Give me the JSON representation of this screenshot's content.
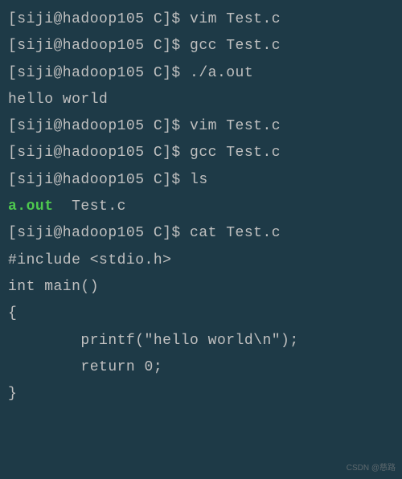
{
  "prompt": "[siji@hadoop105 C]$ ",
  "lines": {
    "cmd1": "vim Test.c",
    "cmd2": "gcc Test.c",
    "cmd3": "./a.out",
    "out1": "hello world",
    "cmd4": "vim Test.c",
    "cmd5": "gcc Test.c",
    "cmd6": "ls",
    "ls_exec": "a.out",
    "ls_file": "  Test.c",
    "cmd7": "cat Test.c",
    "src1": "#include <stdio.h>",
    "src2": "int main()",
    "src3": "{",
    "src4": "        printf(\"hello world\\n\");",
    "src5": "        return 0;",
    "src6": "}"
  },
  "watermark": "CSDN @慈路"
}
